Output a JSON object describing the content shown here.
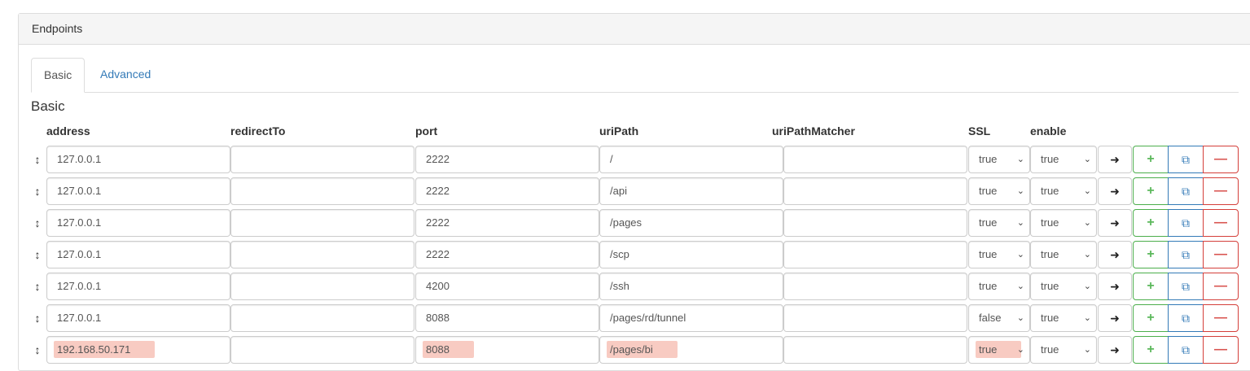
{
  "panel": {
    "title": "Endpoints"
  },
  "tabs": [
    {
      "label": "Basic",
      "active": true
    },
    {
      "label": "Advanced",
      "active": false
    }
  ],
  "section": {
    "title": "Basic"
  },
  "columns": [
    "address",
    "redirectTo",
    "port",
    "uriPath",
    "uriPathMatcher",
    "SSL",
    "enable"
  ],
  "icons": {
    "drag": "↕",
    "login": "sign-in-icon",
    "add": "plus-icon",
    "copy": "copy-icon",
    "remove": "minus-icon",
    "chevron": "chevron-down-icon"
  },
  "colors": {
    "add": "#5cb85c",
    "copy": "#337ab7",
    "remove": "#d9534f",
    "highlight": "#f08c78"
  },
  "rows": [
    {
      "address": "127.0.0.1",
      "redirectTo": "",
      "port": "2222",
      "uriPath": "/",
      "uriPathMatcher": "",
      "ssl": "true",
      "enable": "true"
    },
    {
      "address": "127.0.0.1",
      "redirectTo": "",
      "port": "2222",
      "uriPath": "/api",
      "uriPathMatcher": "",
      "ssl": "true",
      "enable": "true"
    },
    {
      "address": "127.0.0.1",
      "redirectTo": "",
      "port": "2222",
      "uriPath": "/pages",
      "uriPathMatcher": "",
      "ssl": "true",
      "enable": "true"
    },
    {
      "address": "127.0.0.1",
      "redirectTo": "",
      "port": "2222",
      "uriPath": "/scp",
      "uriPathMatcher": "",
      "ssl": "true",
      "enable": "true"
    },
    {
      "address": "127.0.0.1",
      "redirectTo": "",
      "port": "4200",
      "uriPath": "/ssh",
      "uriPathMatcher": "",
      "ssl": "true",
      "enable": "true"
    },
    {
      "address": "127.0.0.1",
      "redirectTo": "",
      "port": "8088",
      "uriPath": "/pages/rd/tunnel",
      "uriPathMatcher": "",
      "ssl": "false",
      "enable": "true"
    },
    {
      "address": "192.168.50.171",
      "redirectTo": "",
      "port": "8088",
      "uriPath": "/pages/bi",
      "uriPathMatcher": "",
      "ssl": "true",
      "enable": "true",
      "highlighted": true
    }
  ]
}
